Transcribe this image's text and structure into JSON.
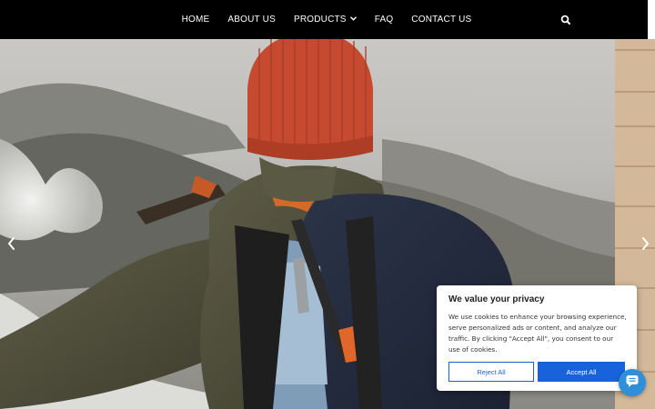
{
  "nav": {
    "items": [
      {
        "label": "HOME"
      },
      {
        "label": "ABOUT US"
      },
      {
        "label": "PRODUCTS",
        "has_dropdown": true
      },
      {
        "label": "FAQ"
      },
      {
        "label": "CONTACT US"
      }
    ],
    "search_icon": "search-icon"
  },
  "hero": {
    "image": "hiker-with-backpack-and-red-beanie",
    "prev_icon": "chevron-left-icon",
    "next_icon": "chevron-right-icon"
  },
  "cookie_banner": {
    "title": "We value your privacy",
    "text": "We use cookies to enhance your browsing experience, serve personalized ads or content, and analyze our traffic. By clicking \"Accept All\", you consent to our use of cookies.",
    "reject_label": "Reject All",
    "accept_label": "Accept All",
    "accent_color": "#1863dc"
  },
  "chat_widget": {
    "icon": "chat-icon",
    "color": "#2f8fd8"
  }
}
